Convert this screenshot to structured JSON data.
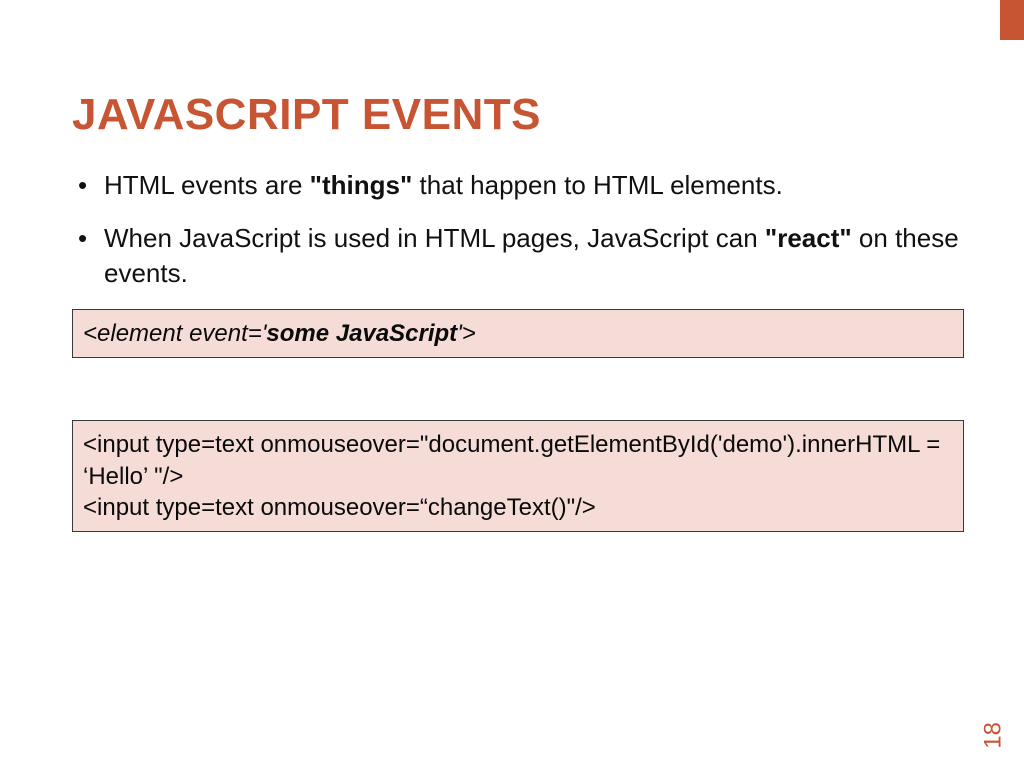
{
  "title": "JAVASCRIPT EVENTS",
  "bullets": {
    "b1_pre": "HTML events are ",
    "b1_bold": "\"things\"",
    "b1_post": " that happen to HTML elements.",
    "b2_pre": "When JavaScript is used in HTML pages, JavaScript can ",
    "b2_bold": "\"react\"",
    "b2_post": " on these events."
  },
  "syntax": {
    "lt": "<",
    "elem": "element",
    "sp": " ",
    "event": "event",
    "eq": "=",
    "q1": "'",
    "js": "some JavaScript",
    "q2": "'",
    "gt": ">"
  },
  "example": {
    "line1": "<input type=text onmouseover=\"document.getElementById('demo').innerHTML = ‘Hello’ \"/>",
    "line2": "<input type=text onmouseover=“changeText()\"/>"
  },
  "page_number": "18"
}
